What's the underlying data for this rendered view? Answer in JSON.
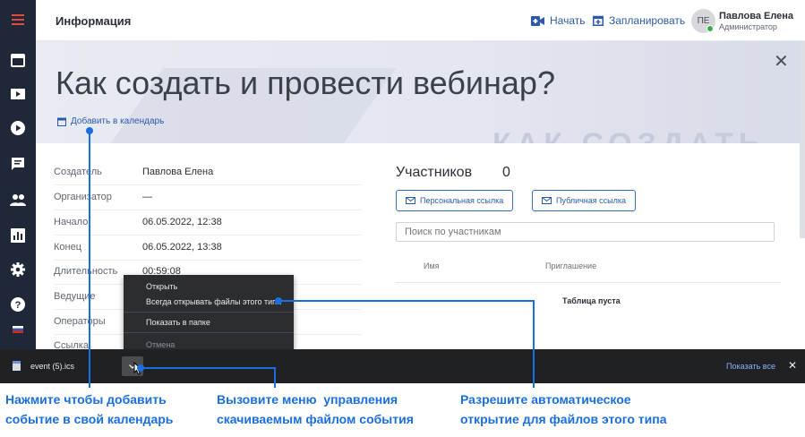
{
  "header": {
    "title": "Информация",
    "start_label": "Начать",
    "schedule_label": "Запланировать",
    "avatar_initials": "ПЕ",
    "user_name": "Павлова Елена",
    "user_role": "Администратор"
  },
  "banner": {
    "title": "Как создать и провести вебинар?",
    "add_to_calendar": "Добавить в календарь",
    "background_text": "КАК СОЗДАТЬ"
  },
  "details": {
    "rows": [
      {
        "label": "Создатель",
        "value": "Павлова Елена"
      },
      {
        "label": "Организатор",
        "value": "—"
      },
      {
        "label": "Начало",
        "value": "06.05.2022, 12:38"
      },
      {
        "label": "Конец",
        "value": "06.05.2022, 13:38"
      },
      {
        "label": "Длительность",
        "value": "00:59:08"
      },
      {
        "label": "Ведущие",
        "value": ""
      },
      {
        "label": "Операторы",
        "value": ""
      },
      {
        "label": "Ссылка",
        "value": ""
      }
    ]
  },
  "participants": {
    "title": "Участников",
    "count": "0",
    "personal_link": "Персональная ссылка",
    "public_link": "Публичная ссылка",
    "search_placeholder": "Поиск по участникам",
    "col_name": "Имя",
    "col_invite": "Приглашение",
    "empty": "Таблица пуста"
  },
  "context_menu": {
    "open": "Открыть",
    "always_open": "Всегда открывать файлы этого типа",
    "show_in_folder": "Показать в папке",
    "cancel": "Отмена"
  },
  "download_bar": {
    "file_name": "event (5).ics",
    "show_all": "Показать все"
  },
  "annotations": {
    "a1": [
      "Нажмите чтобы добавить",
      "событие в свой календарь"
    ],
    "a2": [
      "Вызовите меню  управления",
      "скачиваемым файлом события"
    ],
    "a3": [
      "Разрешите автоматическое",
      "открытие для файлов этого типа"
    ]
  },
  "colors": {
    "sidebar": "#1f2838",
    "accent": "#2c5aa8",
    "annotation": "#1a6fe0",
    "download_bar": "#202124",
    "online": "#32b24b"
  }
}
